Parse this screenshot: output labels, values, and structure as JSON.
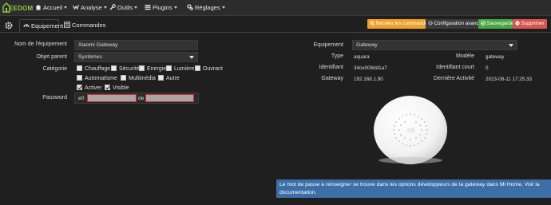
{
  "nav": {
    "brand": "EEDOM",
    "items": [
      {
        "label": "Accueil",
        "icon": "home-icon"
      },
      {
        "label": "Analyse",
        "icon": "analysis-icon"
      },
      {
        "label": "Outils",
        "icon": "wrench-icon"
      },
      {
        "label": "Plugins",
        "icon": "tasks-icon"
      },
      {
        "label": "Réglages",
        "icon": "gears-icon"
      }
    ]
  },
  "tabs": {
    "equipment": "Equipement",
    "commands": "Commandes"
  },
  "actions": {
    "recreate": "Recréer les commandes",
    "advanced": "Configuration avancée",
    "save": "Sauvegarder",
    "delete": "Supprimer"
  },
  "form": {
    "name_label": "Nom de l'équipement",
    "name_value": "Xiaomi Gateway",
    "parent_label": "Objet parent",
    "parent_value": "Systèmes",
    "category_label": "Catégorie",
    "categories": [
      {
        "label": "Chauffage",
        "checked": false
      },
      {
        "label": "Sécurité",
        "checked": false
      },
      {
        "label": "Energie",
        "checked": false
      },
      {
        "label": "Lumière",
        "checked": false
      },
      {
        "label": "Ouvrant",
        "checked": false
      },
      {
        "label": "Automatisme",
        "checked": false
      },
      {
        "label": "Multimédia",
        "checked": false
      },
      {
        "label": "Autre",
        "checked": false
      }
    ],
    "activate_label": "Activer",
    "visible_label": "Visible",
    "password_label": "Password",
    "password_prefix": "e0",
    "password_mid": "de"
  },
  "right": {
    "equipment_label": "Equipement",
    "equipment_value": "Gateway",
    "type_label": "Type",
    "type_value": "aquara",
    "model_label": "Modèle",
    "model_value": "gateway",
    "identifier_label": "Identifiant",
    "identifier_value": "34ce008dd1a7",
    "short_id_label": "Identifiant court",
    "short_id_value": "0",
    "gateway_label": "Gateway",
    "gateway_value": "192.168.1.90",
    "last_activity_label": "Dernière Activité",
    "last_activity_value": "2023-08-11 17:25:33"
  },
  "info": "Le mot de passe à renseigner se trouve dans les options développeurs de la gateway dans Mi Home. Voir la documentation.",
  "colors": {
    "brand": "#93c83e",
    "orange": "#f0a02c",
    "green": "#4aa547",
    "red": "#d9534f",
    "info": "#3c6fa7"
  }
}
